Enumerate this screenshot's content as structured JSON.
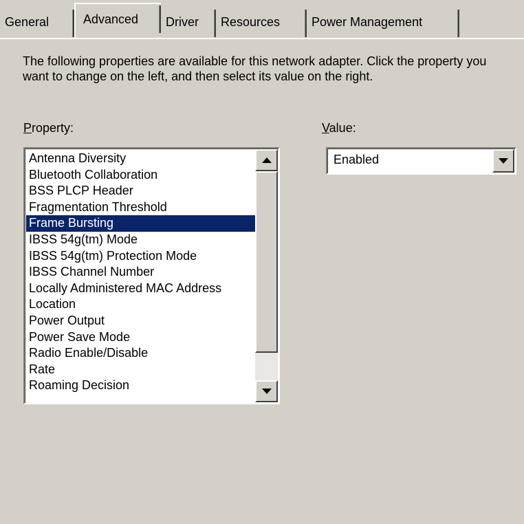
{
  "tabs": [
    {
      "label": "General",
      "active": false
    },
    {
      "label": "Advanced",
      "active": true
    },
    {
      "label": "Driver",
      "active": false
    },
    {
      "label": "Resources",
      "active": false
    },
    {
      "label": "Power Management",
      "active": false
    }
  ],
  "description": "The following properties are available for this network adapter. Click the property you want to change on the left, and then select its value on the right.",
  "property": {
    "label_accel": "P",
    "label_rest": "roperty:",
    "items": [
      "Antenna Diversity",
      "Bluetooth Collaboration",
      "BSS PLCP Header",
      "Fragmentation Threshold",
      "Frame Bursting",
      "IBSS 54g(tm) Mode",
      "IBSS 54g(tm) Protection Mode",
      "IBSS Channel Number",
      "Locally Administered MAC Address",
      "Location",
      "Power Output",
      "Power Save Mode",
      "Radio Enable/Disable",
      "Rate",
      "Roaming Decision"
    ],
    "selected_index": 4
  },
  "value": {
    "label_accel": "V",
    "label_rest": "alue:",
    "selected": "Enabled"
  },
  "icons": {
    "scroll_up": "scroll-up-arrow-icon",
    "scroll_down": "scroll-down-arrow-icon",
    "dropdown": "dropdown-arrow-icon"
  },
  "colors": {
    "dialog_bg": "#d4d0c8",
    "selection_bg": "#0a246a",
    "selection_fg": "#ffffff"
  }
}
